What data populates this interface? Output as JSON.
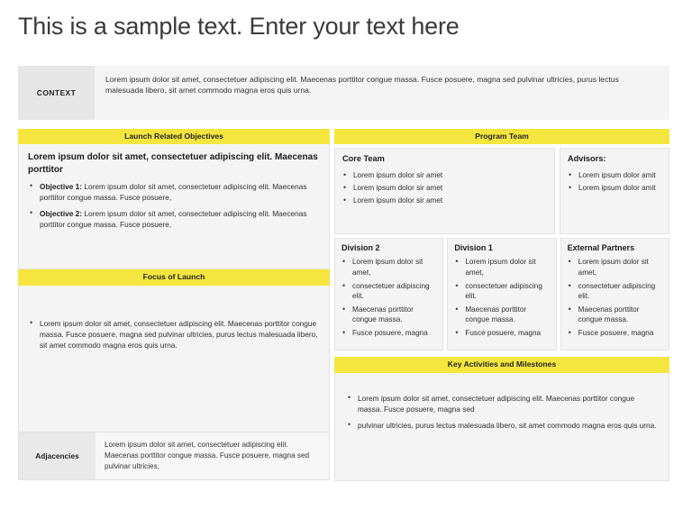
{
  "slide": {
    "title": "This is a sample text. Enter your text here",
    "accent_color": "#F5E63F",
    "panel_bg": "#F4F4F4",
    "label_bg": "#E6E6E6"
  },
  "context": {
    "label": "CONTEXT",
    "body": "Lorem ipsum dolor sit amet, consectetuer adipiscing elit. Maecenas porttitor congue massa. Fusce posuere, magna sed pulvinar ultricies, purus lectus malesuada libero, sit amet commodo magna eros quis urna."
  },
  "launch_objectives": {
    "header": "Launch Related Objectives",
    "intro": "Lorem ipsum dolor sit amet, consectetuer adipiscing elit. Maecenas porttitor",
    "items": [
      {
        "label": "Objective 1:",
        "text": " Lorem ipsum dolor sit amet, consectetuer adipiscing elit. Maecenas porttitor congue massa. Fusce posuere,"
      },
      {
        "label": "Objective 2:",
        "text": " Lorem ipsum dolor sit amet, consectetuer adipiscing elit. Maecenas porttitor congue massa. Fusce posuere,"
      }
    ]
  },
  "focus_of_launch": {
    "header": "Focus of Launch",
    "items": [
      "Lorem ipsum dolor sit amet, consectetuer adipiscing elit. Maecenas porttitor congue massa. Fusce posuere, magna sed pulvinar ultricies, purus lectus malesuada libero, sit amet commodo magna eros quis urna."
    ]
  },
  "adjacencies": {
    "label": "Adjacencies",
    "body": "Lorem ipsum dolor sit amet, consectetuer adipiscing elit. Maecenas porttitor congue massa. Fusce posuere, magna sed pulvinar ultricies,"
  },
  "program_team": {
    "header": "Program Team",
    "core_team": {
      "title": "Core Team",
      "items": [
        "Lorem ipsum dolor sir amet",
        "Lorem ipsum dolor sir amet",
        "Lorem ipsum dolor sir amet"
      ]
    },
    "advisors": {
      "title": "Advisors:",
      "items": [
        "Lorem ipsum dolor amit",
        "Lorem ipsum dolor amit"
      ]
    },
    "divisions": [
      {
        "title": "Division 2",
        "items": [
          "Lorem ipsum dolor sit amet,",
          "consectetuer adipiscing elit.",
          "Maecenas porttitor congue massa.",
          "Fusce posuere, magna"
        ]
      },
      {
        "title": "Division 1",
        "items": [
          "Lorem ipsum dolor sit amet,",
          "consectetuer adipiscing elit.",
          "Maecenas porttitor congue massa.",
          "Fusce posuere, magna"
        ]
      },
      {
        "title": "External Partners",
        "items": [
          "Lorem ipsum dolor sit amet,",
          "consectetuer adipiscing elit.",
          "Maecenas porttitor congue massa.",
          "Fusce posuere, magna"
        ]
      }
    ]
  },
  "key_activities": {
    "header": "Key Activities and Milestones",
    "items": [
      "Lorem ipsum dolor sit amet, consectetuer adipiscing elit. Maecenas porttitor congue massa. Fusce posuere, magna sed",
      "pulvinar ultricies, purus lectus malesuada libero, sit amet commodo magna eros quis urna."
    ]
  }
}
